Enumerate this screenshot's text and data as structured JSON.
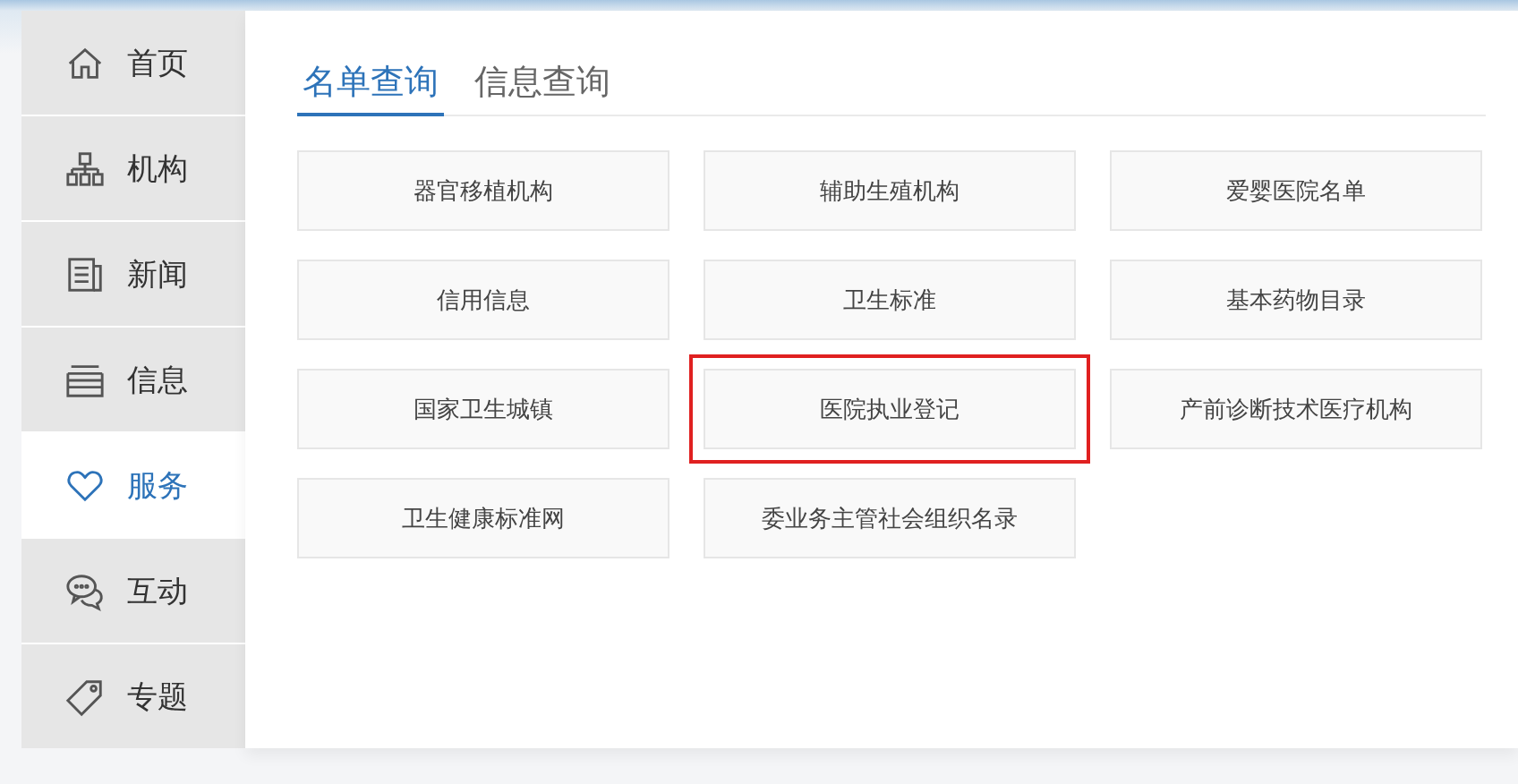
{
  "sidebar": {
    "items": [
      {
        "label": "首页",
        "selected": false
      },
      {
        "label": "机构",
        "selected": false
      },
      {
        "label": "新闻",
        "selected": false
      },
      {
        "label": "信息",
        "selected": false
      },
      {
        "label": "服务",
        "selected": true
      },
      {
        "label": "互动",
        "selected": false
      },
      {
        "label": "专题",
        "selected": false
      }
    ]
  },
  "tabs": [
    {
      "label": "名单查询",
      "selected": true
    },
    {
      "label": "信息查询",
      "selected": false
    }
  ],
  "links": [
    {
      "label": "器官移植机构",
      "highlighted": false
    },
    {
      "label": "辅助生殖机构",
      "highlighted": false
    },
    {
      "label": "爱婴医院名单",
      "highlighted": false
    },
    {
      "label": "信用信息",
      "highlighted": false
    },
    {
      "label": "卫生标准",
      "highlighted": false
    },
    {
      "label": "基本药物目录",
      "highlighted": false
    },
    {
      "label": "国家卫生城镇",
      "highlighted": false
    },
    {
      "label": "医院执业登记",
      "highlighted": true
    },
    {
      "label": "产前诊断技术医疗机构",
      "highlighted": false
    },
    {
      "label": "卫生健康标准网",
      "highlighted": false
    },
    {
      "label": "委业务主管社会组织名录",
      "highlighted": false
    }
  ]
}
